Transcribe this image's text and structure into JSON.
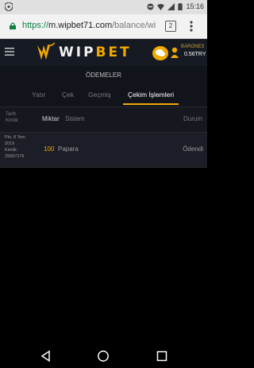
{
  "status_bar": {
    "time": "15:16",
    "icons": [
      "shield-icon",
      "minus-circle-icon",
      "wifi-icon",
      "signal-icon",
      "battery-icon"
    ]
  },
  "browser": {
    "url_scheme": "https://",
    "url_host": "m.wipbet71.com",
    "url_path": "/balance/wi",
    "tab_count": "2"
  },
  "topnav": {
    "logo_left": "WIP",
    "logo_right": "BET",
    "username": "BARONES",
    "balance": "0.56TRY"
  },
  "section_title": "ÖDEMELER",
  "tabs": [
    {
      "label": "Yatır"
    },
    {
      "label": "Çek"
    },
    {
      "label": "Geçmiş"
    },
    {
      "label": "Çekim İşlemleri"
    }
  ],
  "table": {
    "headers": {
      "date": "Tarih",
      "id": "Kimlik",
      "amount": "Miktar",
      "system": "Sistem",
      "status": "Durum"
    },
    "rows": [
      {
        "date_line1": "Pts, 8 Tem",
        "date_line2": "2019",
        "id_label": "Kimlik:",
        "id_value": "29587279",
        "amount": "100",
        "system": "Papara",
        "status": "Ödendi"
      }
    ]
  },
  "colors": {
    "accent": "#f2a900",
    "background": "#000000",
    "header_bg": "#161a22"
  }
}
